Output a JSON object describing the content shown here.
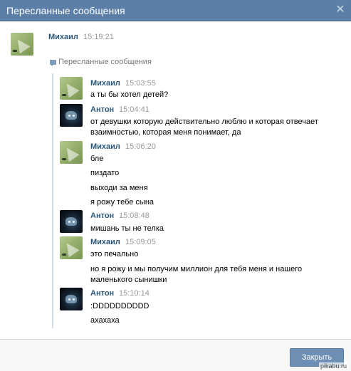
{
  "dialog": {
    "title": "Пересланные сообщения",
    "close_glyph": "✕",
    "close_button_label": "Закрыть"
  },
  "sender": {
    "name": "Михаил",
    "time": "15:19:21",
    "forwarded_label": "Пересланные сообщения"
  },
  "messages": [
    {
      "author": "Михаил",
      "time": "15:03:55",
      "lines": [
        "а ты бы хотел детей?"
      ]
    },
    {
      "author": "Антон",
      "time": "15:04:41",
      "lines": [
        "от девушки которую действительно люблю и которая отвечает",
        "взаимностью, которая меня понимает, да"
      ]
    },
    {
      "author": "Михаил",
      "time": "15:06:20",
      "lines": [
        "бле",
        "пиздато",
        "выходи за меня",
        "я рожу тебе сына"
      ]
    },
    {
      "author": "Антон",
      "time": "15:08:48",
      "lines": [
        "мишань ты не телка"
      ]
    },
    {
      "author": "Михаил",
      "time": "15:09:05",
      "lines": [
        "это печально",
        "но я рожу и мы получим миллион для тебя меня и нашего",
        "маленького сынишки"
      ]
    },
    {
      "author": "Антон",
      "time": "15:10:14",
      "lines": [
        ":DDDDDDDDDD",
        "ахахаха"
      ]
    }
  ],
  "watermark": "pikabu.ru",
  "colors": {
    "titlebar": "#5b7fa6",
    "name_link": "#2b587a",
    "time": "#999999",
    "button": "#6d8fb3"
  }
}
